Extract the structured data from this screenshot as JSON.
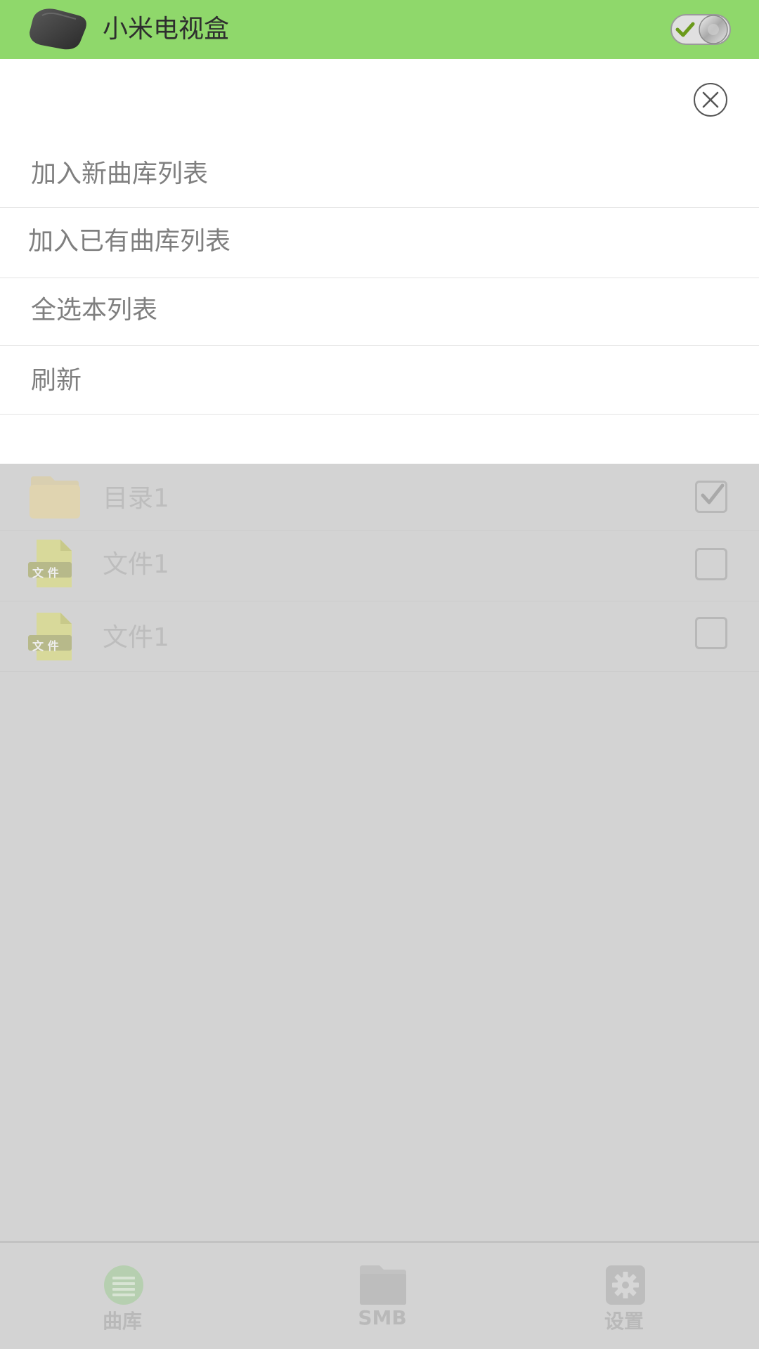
{
  "header": {
    "title": "小米电视盒",
    "device_icon": "tv-box-icon",
    "toggle_icon": "toggle-switch-icon",
    "toggle_state": "on"
  },
  "popup": {
    "close_icon": "close-icon",
    "items": [
      {
        "label": "加入新曲库列表"
      },
      {
        "label": "加入已有曲库列表"
      },
      {
        "label": "全选本列表"
      },
      {
        "label": "刷新"
      }
    ]
  },
  "file_list": {
    "rows": [
      {
        "name": "目录1",
        "icon": "folder-icon",
        "checked": true
      },
      {
        "name": "文件1",
        "icon": "file-icon",
        "icon_text": "文 件",
        "checked": false
      },
      {
        "name": "文件1",
        "icon": "file-icon",
        "icon_text": "文 件",
        "checked": false
      }
    ]
  },
  "tabbar": {
    "tabs": [
      {
        "label": "曲库",
        "icon": "library-icon"
      },
      {
        "label": "SMB",
        "icon": "folder-icon"
      },
      {
        "label": "设置",
        "icon": "gear-icon"
      }
    ]
  },
  "colors": {
    "header_bg": "#8fd86b",
    "overlay_bg": "#d3d3d3",
    "menu_text": "#7f7f7f"
  }
}
